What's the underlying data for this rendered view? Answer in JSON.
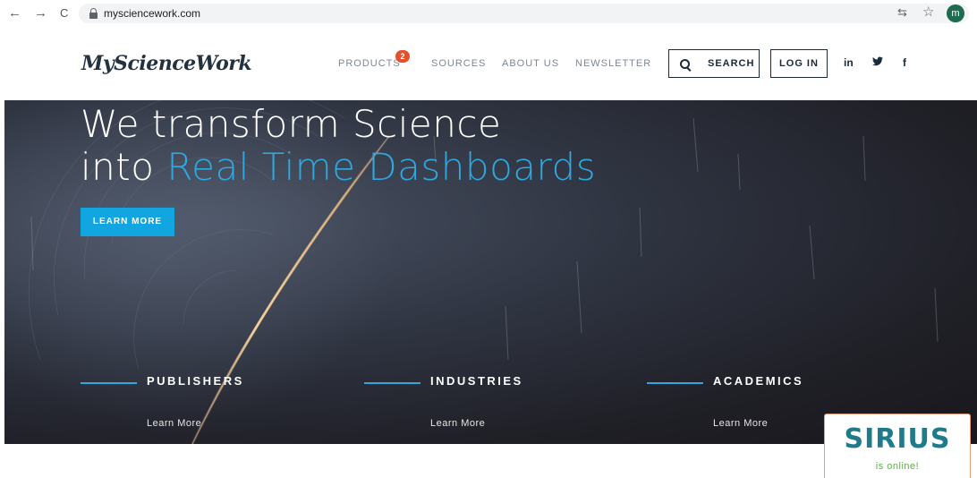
{
  "browser": {
    "url": "mysciencework.com",
    "avatar_letter": "m",
    "back_glyph": "←",
    "forward_glyph": "→",
    "reload_glyph": "C",
    "star_glyph": "☆",
    "translate_glyph": "⇆"
  },
  "header": {
    "logo": "MyScienceWork",
    "menu": {
      "products": "PRODUCTS",
      "products_badge": "2",
      "sources": "SOURCES",
      "about": "ABOUT US",
      "newsletter": "NEWSLETTER"
    },
    "search_label": "SEARCH",
    "login_label": "LOG IN",
    "social": {
      "linkedin": "in",
      "twitter": "🐦",
      "facebook": "f"
    }
  },
  "hero": {
    "title_line1": "We transform Science",
    "title_line2_prefix": "into ",
    "title_line2_highlight": "Real Time Dashboards",
    "cta": "LEARN MORE",
    "accent_color": "#2fa8e0",
    "audiences": [
      {
        "title": "PUBLISHERS",
        "link": "Learn More"
      },
      {
        "title": "INDUSTRIES",
        "link": "Learn More"
      },
      {
        "title": "ACADEMICS",
        "link": "Learn More"
      }
    ]
  },
  "chat_widget": {
    "brand": "SIRIUS",
    "status": "is online!"
  }
}
